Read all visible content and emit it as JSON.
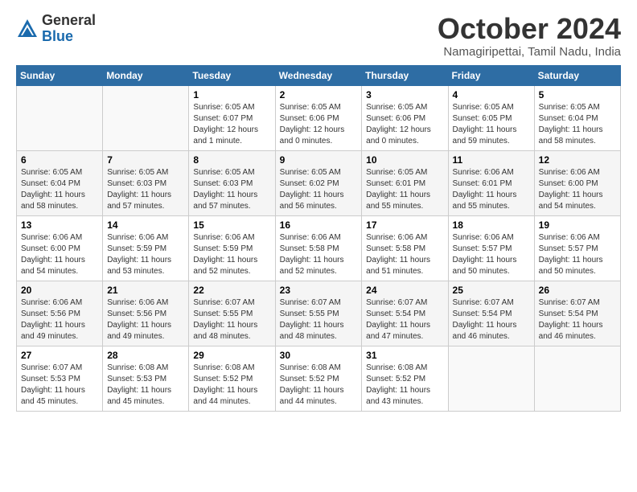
{
  "logo": {
    "general": "General",
    "blue": "Blue"
  },
  "title": "October 2024",
  "location": "Namagiripettai, Tamil Nadu, India",
  "days_of_week": [
    "Sunday",
    "Monday",
    "Tuesday",
    "Wednesday",
    "Thursday",
    "Friday",
    "Saturday"
  ],
  "weeks": [
    [
      {
        "day": "",
        "info": ""
      },
      {
        "day": "",
        "info": ""
      },
      {
        "day": "1",
        "info": "Sunrise: 6:05 AM\nSunset: 6:07 PM\nDaylight: 12 hours\nand 1 minute."
      },
      {
        "day": "2",
        "info": "Sunrise: 6:05 AM\nSunset: 6:06 PM\nDaylight: 12 hours\nand 0 minutes."
      },
      {
        "day": "3",
        "info": "Sunrise: 6:05 AM\nSunset: 6:06 PM\nDaylight: 12 hours\nand 0 minutes."
      },
      {
        "day": "4",
        "info": "Sunrise: 6:05 AM\nSunset: 6:05 PM\nDaylight: 11 hours\nand 59 minutes."
      },
      {
        "day": "5",
        "info": "Sunrise: 6:05 AM\nSunset: 6:04 PM\nDaylight: 11 hours\nand 58 minutes."
      }
    ],
    [
      {
        "day": "6",
        "info": "Sunrise: 6:05 AM\nSunset: 6:04 PM\nDaylight: 11 hours\nand 58 minutes."
      },
      {
        "day": "7",
        "info": "Sunrise: 6:05 AM\nSunset: 6:03 PM\nDaylight: 11 hours\nand 57 minutes."
      },
      {
        "day": "8",
        "info": "Sunrise: 6:05 AM\nSunset: 6:03 PM\nDaylight: 11 hours\nand 57 minutes."
      },
      {
        "day": "9",
        "info": "Sunrise: 6:05 AM\nSunset: 6:02 PM\nDaylight: 11 hours\nand 56 minutes."
      },
      {
        "day": "10",
        "info": "Sunrise: 6:05 AM\nSunset: 6:01 PM\nDaylight: 11 hours\nand 55 minutes."
      },
      {
        "day": "11",
        "info": "Sunrise: 6:06 AM\nSunset: 6:01 PM\nDaylight: 11 hours\nand 55 minutes."
      },
      {
        "day": "12",
        "info": "Sunrise: 6:06 AM\nSunset: 6:00 PM\nDaylight: 11 hours\nand 54 minutes."
      }
    ],
    [
      {
        "day": "13",
        "info": "Sunrise: 6:06 AM\nSunset: 6:00 PM\nDaylight: 11 hours\nand 54 minutes."
      },
      {
        "day": "14",
        "info": "Sunrise: 6:06 AM\nSunset: 5:59 PM\nDaylight: 11 hours\nand 53 minutes."
      },
      {
        "day": "15",
        "info": "Sunrise: 6:06 AM\nSunset: 5:59 PM\nDaylight: 11 hours\nand 52 minutes."
      },
      {
        "day": "16",
        "info": "Sunrise: 6:06 AM\nSunset: 5:58 PM\nDaylight: 11 hours\nand 52 minutes."
      },
      {
        "day": "17",
        "info": "Sunrise: 6:06 AM\nSunset: 5:58 PM\nDaylight: 11 hours\nand 51 minutes."
      },
      {
        "day": "18",
        "info": "Sunrise: 6:06 AM\nSunset: 5:57 PM\nDaylight: 11 hours\nand 50 minutes."
      },
      {
        "day": "19",
        "info": "Sunrise: 6:06 AM\nSunset: 5:57 PM\nDaylight: 11 hours\nand 50 minutes."
      }
    ],
    [
      {
        "day": "20",
        "info": "Sunrise: 6:06 AM\nSunset: 5:56 PM\nDaylight: 11 hours\nand 49 minutes."
      },
      {
        "day": "21",
        "info": "Sunrise: 6:06 AM\nSunset: 5:56 PM\nDaylight: 11 hours\nand 49 minutes."
      },
      {
        "day": "22",
        "info": "Sunrise: 6:07 AM\nSunset: 5:55 PM\nDaylight: 11 hours\nand 48 minutes."
      },
      {
        "day": "23",
        "info": "Sunrise: 6:07 AM\nSunset: 5:55 PM\nDaylight: 11 hours\nand 48 minutes."
      },
      {
        "day": "24",
        "info": "Sunrise: 6:07 AM\nSunset: 5:54 PM\nDaylight: 11 hours\nand 47 minutes."
      },
      {
        "day": "25",
        "info": "Sunrise: 6:07 AM\nSunset: 5:54 PM\nDaylight: 11 hours\nand 46 minutes."
      },
      {
        "day": "26",
        "info": "Sunrise: 6:07 AM\nSunset: 5:54 PM\nDaylight: 11 hours\nand 46 minutes."
      }
    ],
    [
      {
        "day": "27",
        "info": "Sunrise: 6:07 AM\nSunset: 5:53 PM\nDaylight: 11 hours\nand 45 minutes."
      },
      {
        "day": "28",
        "info": "Sunrise: 6:08 AM\nSunset: 5:53 PM\nDaylight: 11 hours\nand 45 minutes."
      },
      {
        "day": "29",
        "info": "Sunrise: 6:08 AM\nSunset: 5:52 PM\nDaylight: 11 hours\nand 44 minutes."
      },
      {
        "day": "30",
        "info": "Sunrise: 6:08 AM\nSunset: 5:52 PM\nDaylight: 11 hours\nand 44 minutes."
      },
      {
        "day": "31",
        "info": "Sunrise: 6:08 AM\nSunset: 5:52 PM\nDaylight: 11 hours\nand 43 minutes."
      },
      {
        "day": "",
        "info": ""
      },
      {
        "day": "",
        "info": ""
      }
    ]
  ]
}
